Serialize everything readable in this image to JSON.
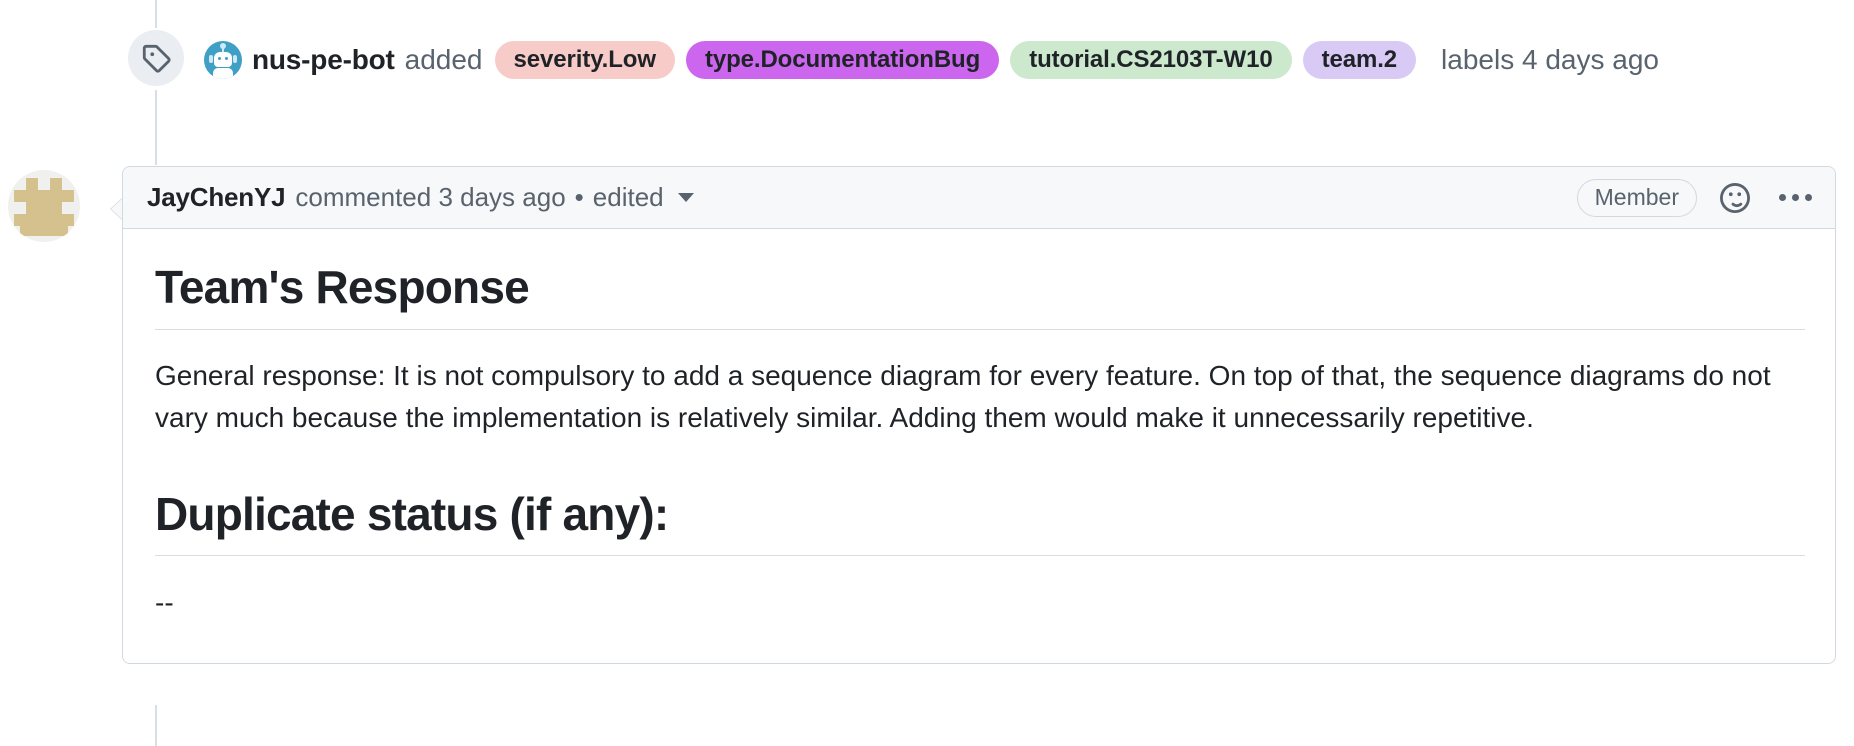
{
  "timeline_event": {
    "icon": "tag-icon",
    "actor": "nus-pe-bot",
    "actor_avatar": "bot-avatar",
    "verb": "added",
    "labels": [
      {
        "name": "severity.Low",
        "bg": "#f7ccc8",
        "fg": "#1f2328"
      },
      {
        "name": "type.DocumentationBug",
        "bg": "#cc66ef",
        "fg": "#1f2328"
      },
      {
        "name": "tutorial.CS2103T-W10",
        "bg": "#cce8cd",
        "fg": "#1f2328"
      },
      {
        "name": "team.2",
        "bg": "#d9c9f5",
        "fg": "#1f2328"
      }
    ],
    "suffix": "labels 4 days ago"
  },
  "comment": {
    "avatar": "identicon-avatar",
    "author": "JayChenYJ",
    "action": "commented 3 days ago",
    "separator": "•",
    "edited": "edited",
    "caret": "chevron-down-icon",
    "member_badge": "Member",
    "reaction_icon": "smiley-icon",
    "menu_icon": "kebab-menu-icon",
    "body": {
      "heading_1": "Team's Response",
      "paragraph_1": "General response: It is not compulsory to add a sequence diagram for every feature. On top of that, the sequence diagrams do not vary much because the implementation is relatively similar. Adding them would make it unnecessarily repetitive.",
      "heading_2": "Duplicate status (if any):",
      "paragraph_2": "--"
    }
  },
  "colors": {
    "border": "#d1d9e0",
    "header_bg": "#f6f8fa",
    "text": "#1f2328",
    "muted": "#59636e",
    "rail": "#d8dee4"
  }
}
